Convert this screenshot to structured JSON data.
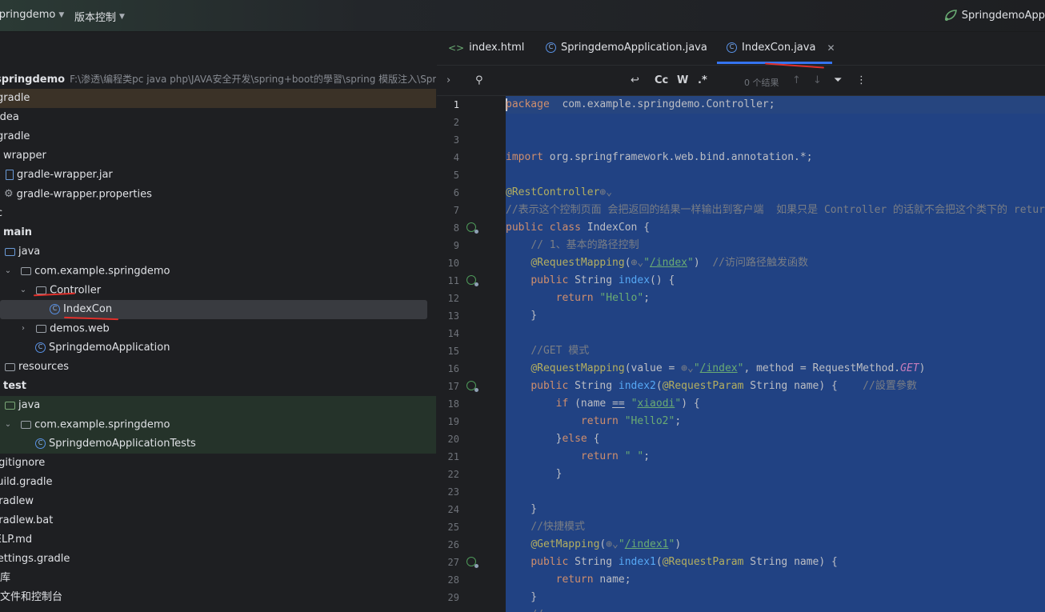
{
  "topbar": {
    "project_menu": "springdemo",
    "vcs_menu": "版本控制",
    "run_config": "SpringdemoApp"
  },
  "project_tree": {
    "root_name": "springdemo",
    "root_path": "F:\\渗透\\编程类pc java php\\JAVA安全开发\\spring+boot的學習\\spring 模版注入\\Springdem",
    "items": [
      {
        "label": "gradle"
      },
      {
        "label": "idea"
      },
      {
        "label": "gradle"
      },
      {
        "label": "wrapper"
      },
      {
        "label": "gradle-wrapper.jar"
      },
      {
        "label": "gradle-wrapper.properties"
      },
      {
        "label": "src"
      },
      {
        "label": "main"
      },
      {
        "label": "java"
      },
      {
        "label": "com.example.springdemo"
      },
      {
        "label": "Controller"
      },
      {
        "label": "IndexCon"
      },
      {
        "label": "demos.web"
      },
      {
        "label": "SpringdemoApplication"
      },
      {
        "label": "resources"
      },
      {
        "label": "test"
      },
      {
        "label": "java"
      },
      {
        "label": "com.example.springdemo"
      },
      {
        "label": "SpringdemoApplicationTests"
      },
      {
        "label": ".gitignore"
      },
      {
        "label": "build.gradle"
      },
      {
        "label": "gradlew"
      },
      {
        "label": "gradlew.bat"
      },
      {
        "label": "HELP.md"
      },
      {
        "label": "settings.gradle"
      },
      {
        "label": "外部库"
      },
      {
        "label": "临时文件和控制台"
      }
    ]
  },
  "editor": {
    "tabs": [
      {
        "label": "index.html"
      },
      {
        "label": "SpringdemoApplication.java"
      },
      {
        "label": "IndexCon.java"
      }
    ],
    "find": {
      "match_case": "Cc",
      "words": "W",
      "regex": ".*",
      "results": "0 个结果"
    },
    "line_numbers": [
      "1",
      "2",
      "3",
      "4",
      "5",
      "6",
      "7",
      "8",
      "9",
      "10",
      "11",
      "12",
      "13",
      "14",
      "15",
      "16",
      "17",
      "18",
      "19",
      "20",
      "21",
      "22",
      "23",
      "24",
      "25",
      "26",
      "27",
      "28",
      "29"
    ]
  },
  "colors": {
    "selection": "#214283",
    "accent": "#3574f0",
    "annotation_red": "#e0302b"
  }
}
